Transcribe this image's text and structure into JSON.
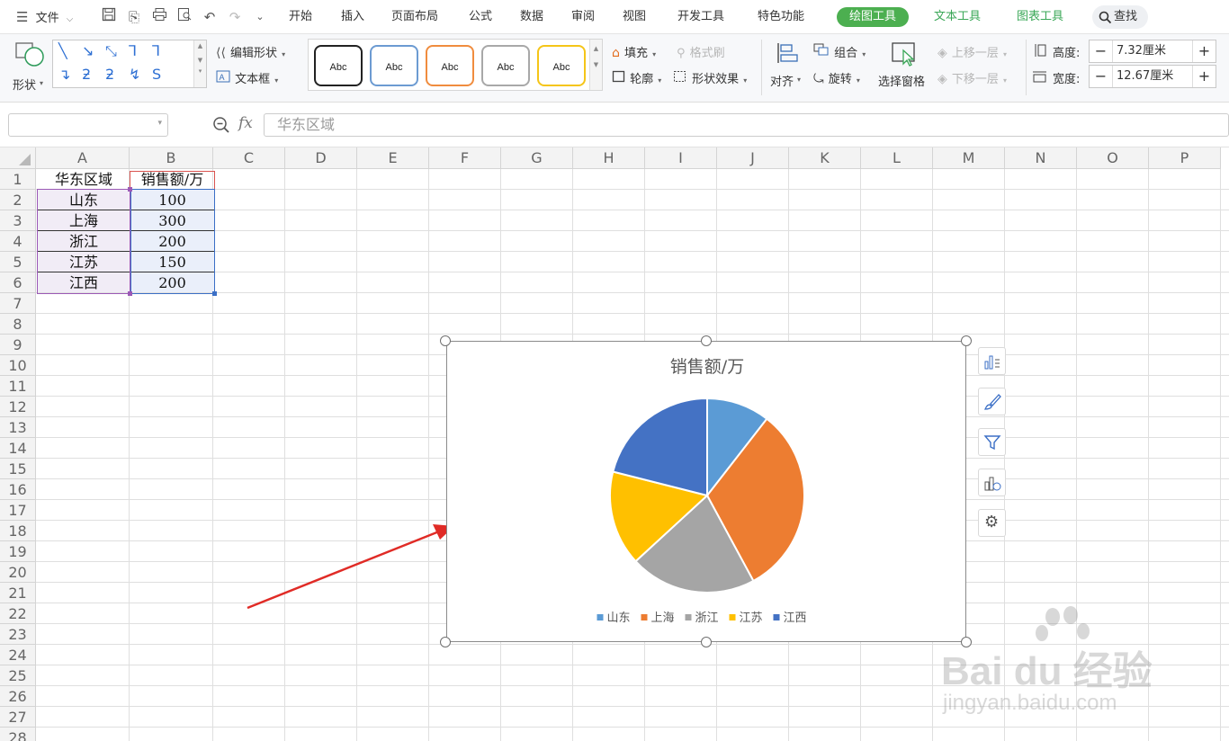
{
  "menubar": {
    "file_label": "文件",
    "tabs": [
      "开始",
      "插入",
      "页面布局",
      "公式",
      "数据",
      "审阅",
      "视图",
      "开发工具",
      "特色功能"
    ],
    "context_tabs": {
      "drawing_tools": "绘图工具",
      "text_tools": "文本工具",
      "chart_tools": "图表工具"
    },
    "search_label": "查找"
  },
  "ribbon": {
    "shape_label": "形状",
    "edit_shape": "编辑形状",
    "text_box": "文本框",
    "style_previews": [
      "Abc",
      "Abc",
      "Abc",
      "Abc",
      "Abc"
    ],
    "fill": "填充",
    "outline": "轮廓",
    "format_painter": "格式刷",
    "shape_effects": "形状效果",
    "align": "对齐",
    "group": "组合",
    "rotate": "旋转",
    "select_pane": "选择窗格",
    "bring_forward": "上移一层",
    "send_backward": "下移一层",
    "height_label": "高度:",
    "height_value": "7.32厘米",
    "width_label": "宽度:",
    "width_value": "12.67厘米"
  },
  "formula_bar": {
    "fx": "fx",
    "content": "华东区域"
  },
  "grid": {
    "columns": [
      "A",
      "B",
      "C",
      "D",
      "E",
      "F",
      "G",
      "H",
      "I",
      "J",
      "K",
      "L",
      "M",
      "N",
      "O",
      "P"
    ],
    "rows": [
      "1",
      "2",
      "3",
      "4",
      "5",
      "6",
      "7",
      "8",
      "9",
      "10",
      "11",
      "12",
      "13",
      "14",
      "15",
      "16",
      "17",
      "18",
      "19",
      "20",
      "21",
      "22",
      "23",
      "24",
      "25",
      "26",
      "27",
      "28"
    ],
    "table": {
      "header": [
        "华东区域",
        "销售额/万"
      ],
      "rows": [
        [
          "山东",
          "100"
        ],
        [
          "上海",
          "300"
        ],
        [
          "浙江",
          "200"
        ],
        [
          "江苏",
          "150"
        ],
        [
          "江西",
          "200"
        ]
      ]
    }
  },
  "chart_data": {
    "type": "pie",
    "title": "销售额/万",
    "categories": [
      "山东",
      "上海",
      "浙江",
      "江苏",
      "江西"
    ],
    "values": [
      100,
      300,
      200,
      150,
      200
    ],
    "colors": [
      "#5b9bd5",
      "#ed7d31",
      "#a5a5a5",
      "#ffc000",
      "#4472c4"
    ],
    "legend_position": "bottom"
  },
  "watermark": {
    "brand": "Bai du 经验",
    "url": "jingyan.baidu.com"
  }
}
